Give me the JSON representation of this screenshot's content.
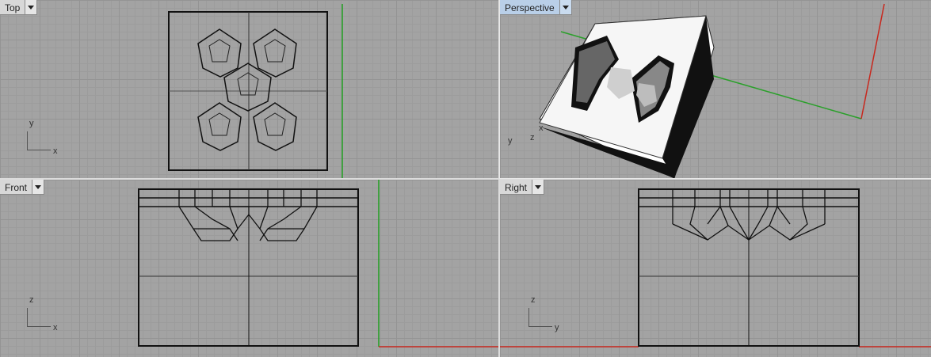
{
  "viewports": {
    "top": {
      "label": "Top",
      "axis_h": "x",
      "axis_v": "y"
    },
    "perspective": {
      "label": "Perspective",
      "axis_a": "y",
      "axis_b": "z",
      "axis_c": "x"
    },
    "front": {
      "label": "Front",
      "axis_h": "x",
      "axis_v": "z"
    },
    "right": {
      "label": "Right",
      "axis_h": "y",
      "axis_v": "z"
    }
  },
  "colors": {
    "background": "#a3a3a3",
    "grid_major": "#949494",
    "grid_minor": "#9c9c9c",
    "x_axis": "#c8281e",
    "y_axis": "#2aa02a",
    "active_tab": "#b9cfe8"
  }
}
